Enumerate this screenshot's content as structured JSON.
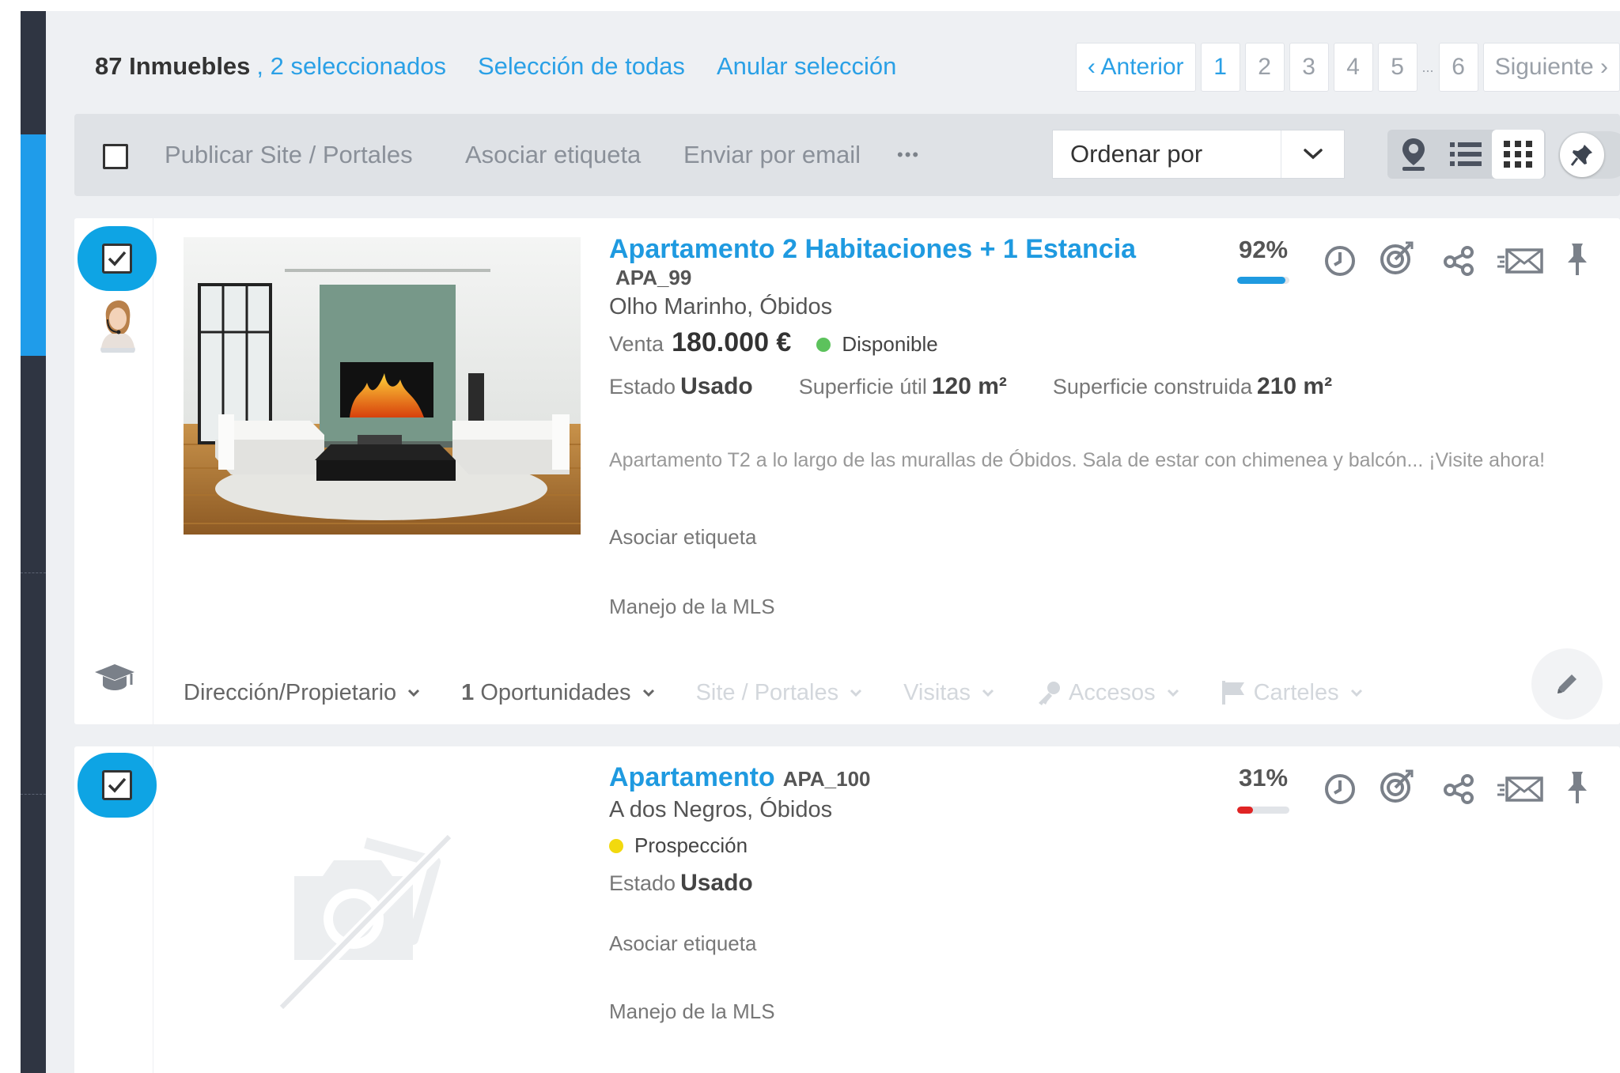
{
  "header": {
    "count": "87 Inmuebles",
    "selected": ", 2 seleccionados",
    "select_all": "Selección de todas",
    "clear_selection": "Anular selección"
  },
  "pagination": {
    "prev": "‹ Anterior",
    "pages": [
      "1",
      "2",
      "3",
      "4",
      "5"
    ],
    "ellipsis": "...",
    "last": "6",
    "next": "Siguiente ›",
    "current": "1"
  },
  "toolbar": {
    "publish": "Publicar Site / Portales",
    "tag": "Asociar etiqueta",
    "email": "Enviar por email",
    "more": "•••",
    "sort_label": "Ordenar por"
  },
  "listings": [
    {
      "title": "Apartamento 2 Habitaciones + 1 Estancia",
      "ref": "APA_99",
      "location": "Olho Marinho, Óbidos",
      "operation": "Venta",
      "price": "180.000 €",
      "status": "Disponible",
      "status_color": "#5cc25c",
      "estado_label": "Estado",
      "estado": "Usado",
      "util_label": "Superficie útil",
      "util": "120 m²",
      "const_label": "Superficie construida",
      "const": "210 m²",
      "description": "Apartamento T2 a lo largo de las murallas de Óbidos. Sala de estar con chimenea y balcón... ¡Visite ahora!",
      "tag_link": "Asociar etiqueta",
      "mls_link": "Manejo de la MLS",
      "percent": "92%",
      "percent_value": 0.92,
      "bar_color": "#1f9ae0",
      "footer": {
        "owner": "Dirección/Propietario",
        "opp_count": "1",
        "opportunities": "Oportunidades",
        "portals": "Site / Portales",
        "visits": "Visitas",
        "access": "Accesos",
        "signs": "Carteles"
      }
    },
    {
      "title": "Apartamento",
      "ref": "APA_100",
      "location": "A dos Negros, Óbidos",
      "status": "Prospección",
      "status_color": "#f2d90e",
      "estado_label": "Estado",
      "estado": "Usado",
      "tag_link": "Asociar etiqueta",
      "mls_link": "Manejo de la MLS",
      "percent": "31%",
      "percent_value": 0.31,
      "bar_color": "#e02424"
    }
  ]
}
